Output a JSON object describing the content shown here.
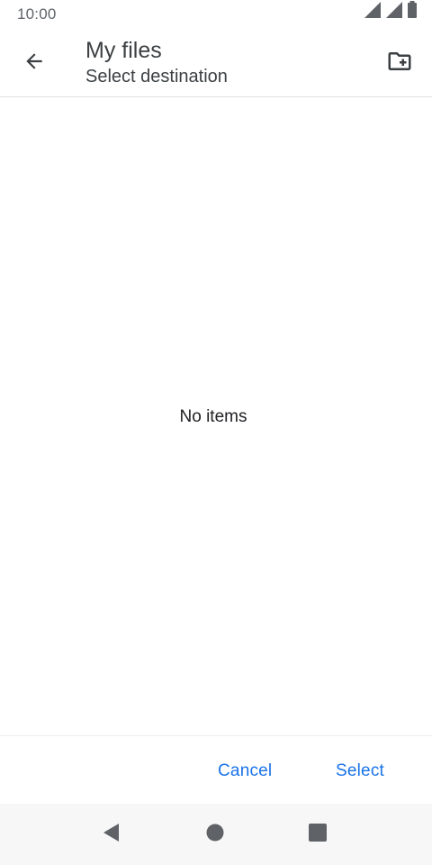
{
  "status_bar": {
    "time": "10:00",
    "icons": [
      "signal-icon",
      "signal-icon",
      "battery-icon"
    ]
  },
  "app_bar": {
    "title": "My files",
    "subtitle": "Select destination",
    "back_icon": "arrow-back-icon",
    "new_folder_icon": "create-new-folder-icon"
  },
  "content": {
    "empty_message": "No items"
  },
  "actions": {
    "cancel_label": "Cancel",
    "select_label": "Select"
  },
  "nav_bar": {
    "icons": [
      "nav-back-icon",
      "nav-home-icon",
      "nav-recents-icon"
    ]
  },
  "colors": {
    "accent": "#1a73e8",
    "icon": "#5f6368",
    "text": "#202124"
  }
}
